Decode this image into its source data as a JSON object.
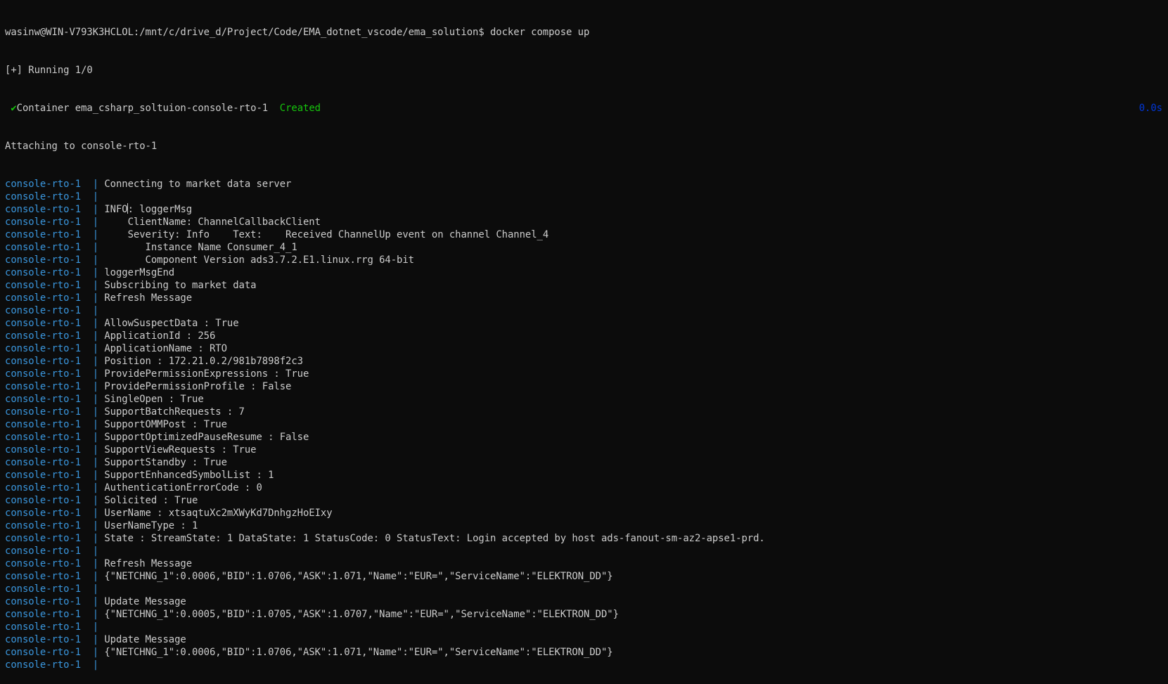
{
  "terminal": {
    "prompt": "wasinw@WIN-V793K3HCLOL:/mnt/c/drive_d/Project/Code/EMA_dotnet_vscode/ema_solution$ docker compose up",
    "running": "[+] Running 1/0",
    "container": {
      "check_icon": "✔",
      "label": "Container ema_csharp_soltuion-console-rto-1",
      "status": "Created",
      "elapsed": "0.0s"
    },
    "attaching": "Attaching to console-rto-1",
    "prefix": "console-rto-1",
    "separator": "|",
    "log_lines": [
      "Connecting to market data server",
      "",
      "INFO",
      "    ClientName: ChannelCallbackClient",
      "    Severity: Info    Text:    Received ChannelUp event on channel Channel_4",
      "       Instance Name Consumer_4_1",
      "       Component Version ads3.7.2.E1.linux.rrg 64-bit",
      "loggerMsgEnd",
      "Subscribing to market data",
      "Refresh Message",
      "",
      "AllowSuspectData : True",
      "ApplicationId : 256",
      "ApplicationName : RTO",
      "Position : 172.21.0.2/981b7898f2c3",
      "ProvidePermissionExpressions : True",
      "ProvidePermissionProfile : False",
      "SingleOpen : True",
      "SupportBatchRequests : 7",
      "SupportOMMPost : True",
      "SupportOptimizedPauseResume : False",
      "SupportViewRequests : True",
      "SupportStandby : True",
      "SupportEnhancedSymbolList : 1",
      "AuthenticationErrorCode : 0",
      "Solicited : True",
      "UserName : xtsaqtuXc2mXWyKd7DnhgzHoEIxy",
      "UserNameType : 1",
      "State : StreamState: 1 DataState: 1 StatusCode: 0 StatusText: Login accepted by host ads-fanout-sm-az2-apse1-prd.",
      "",
      "Refresh Message",
      "{\"NETCHNG_1\":0.0006,\"BID\":1.0706,\"ASK\":1.071,\"Name\":\"EUR=\",\"ServiceName\":\"ELEKTRON_DD\"}",
      "",
      "Update Message",
      "{\"NETCHNG_1\":0.0005,\"BID\":1.0705,\"ASK\":1.0707,\"Name\":\"EUR=\",\"ServiceName\":\"ELEKTRON_DD\"}",
      "",
      "Update Message",
      "{\"NETCHNG_1\":0.0006,\"BID\":1.0706,\"ASK\":1.071,\"Name\":\"EUR=\",\"ServiceName\":\"ELEKTRON_DD\"}",
      ""
    ],
    "info_suffix": ": loggerMsg"
  }
}
